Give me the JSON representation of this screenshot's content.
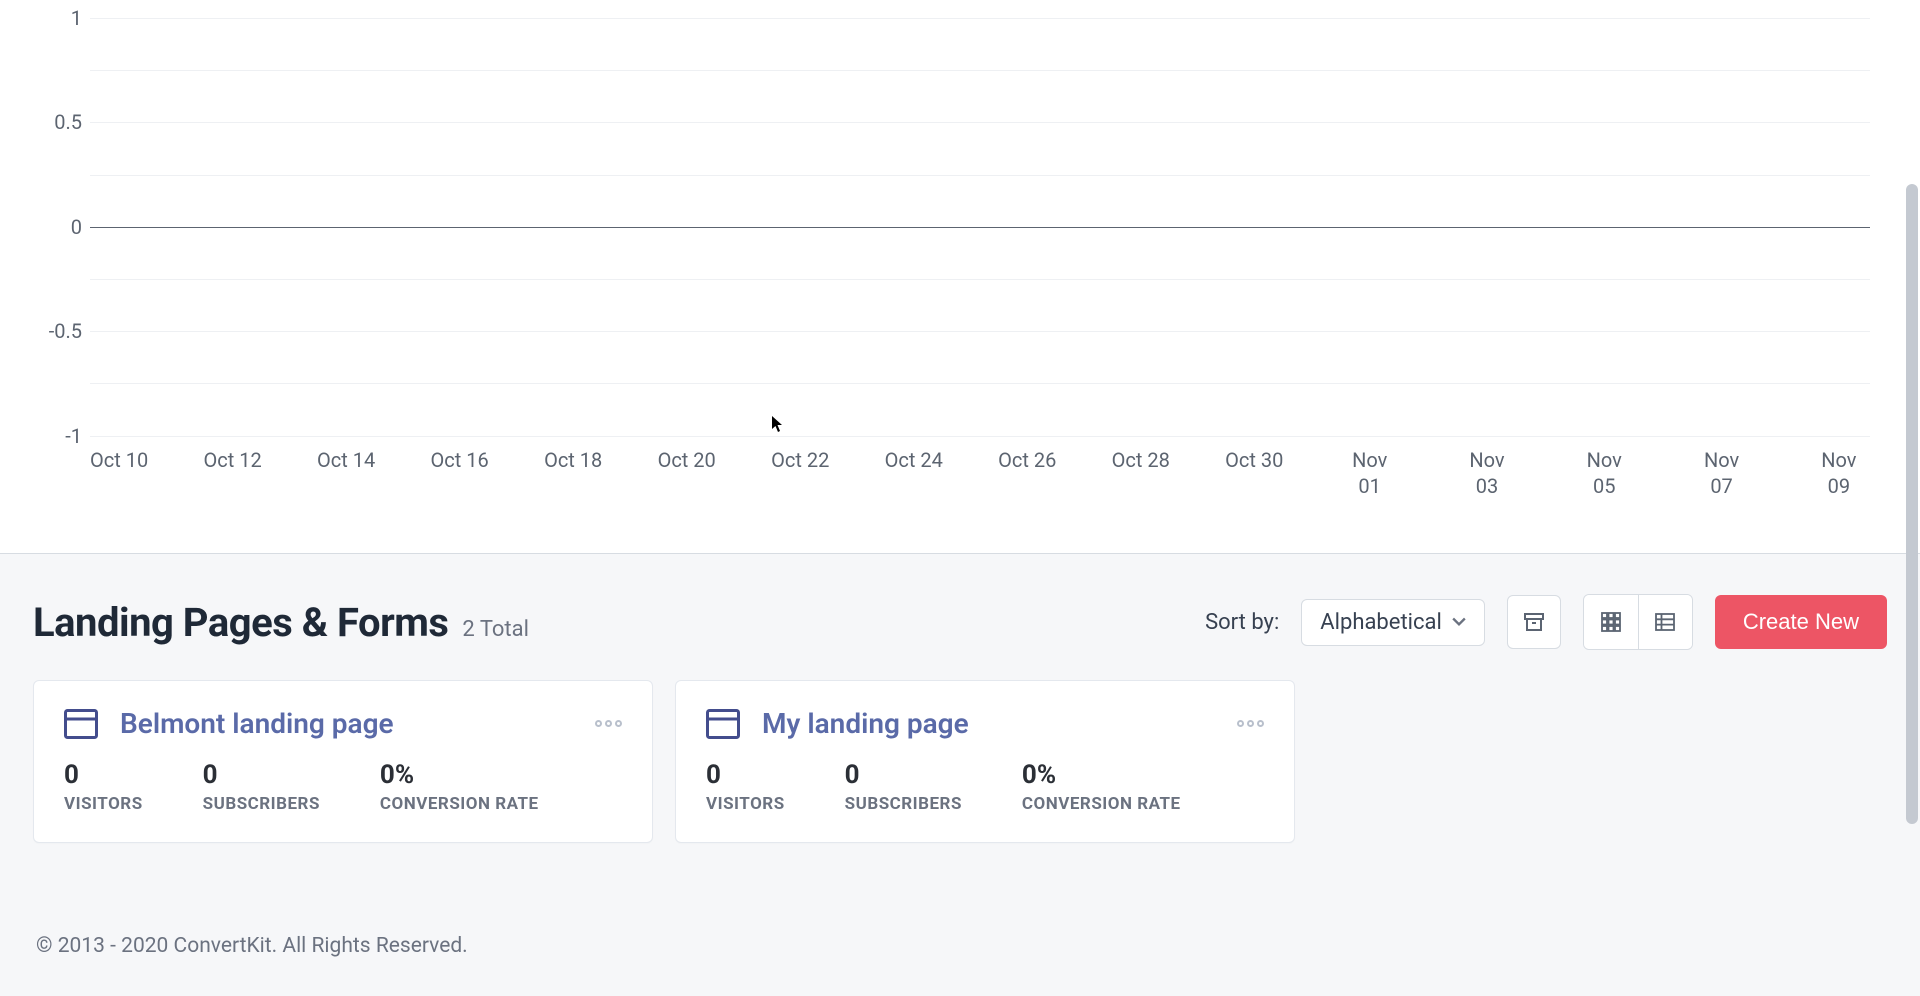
{
  "chart_data": {
    "type": "line",
    "categories": [
      "Oct 10",
      "Oct 12",
      "Oct 14",
      "Oct 16",
      "Oct 18",
      "Oct 20",
      "Oct 22",
      "Oct 24",
      "Oct 26",
      "Oct 28",
      "Oct 30",
      "Nov 01",
      "Nov 03",
      "Nov 05",
      "Nov 07",
      "Nov 09"
    ],
    "series": [
      {
        "name": "",
        "values": [
          0,
          0,
          0,
          0,
          0,
          0,
          0,
          0,
          0,
          0,
          0,
          0,
          0,
          0,
          0,
          0
        ]
      }
    ],
    "y_ticks": [
      1,
      0.5,
      0,
      -0.5,
      -1
    ],
    "ylim": [
      -1,
      1
    ],
    "title": "",
    "xlabel": "",
    "ylabel": ""
  },
  "section": {
    "title": "Landing Pages & Forms",
    "total_text": "2 Total"
  },
  "controls": {
    "sort_by_label": "Sort by:",
    "sort_value": "Alphabetical",
    "create_button": "Create New"
  },
  "cards": [
    {
      "title": "Belmont landing page",
      "stats": {
        "visitors_value": "0",
        "visitors_label": "VISITORS",
        "subscribers_value": "0",
        "subscribers_label": "SUBSCRIBERS",
        "conversion_value": "0%",
        "conversion_label": "CONVERSION RATE"
      }
    },
    {
      "title": "My landing page",
      "stats": {
        "visitors_value": "0",
        "visitors_label": "VISITORS",
        "subscribers_value": "0",
        "subscribers_label": "SUBSCRIBERS",
        "conversion_value": "0%",
        "conversion_label": "CONVERSION RATE"
      }
    }
  ],
  "footer": {
    "copyright": "© 2013 - 2020 ConvertKit. All Rights Reserved."
  },
  "colors": {
    "primary_button": "#ed5565",
    "title_link": "#5a6aa8"
  }
}
